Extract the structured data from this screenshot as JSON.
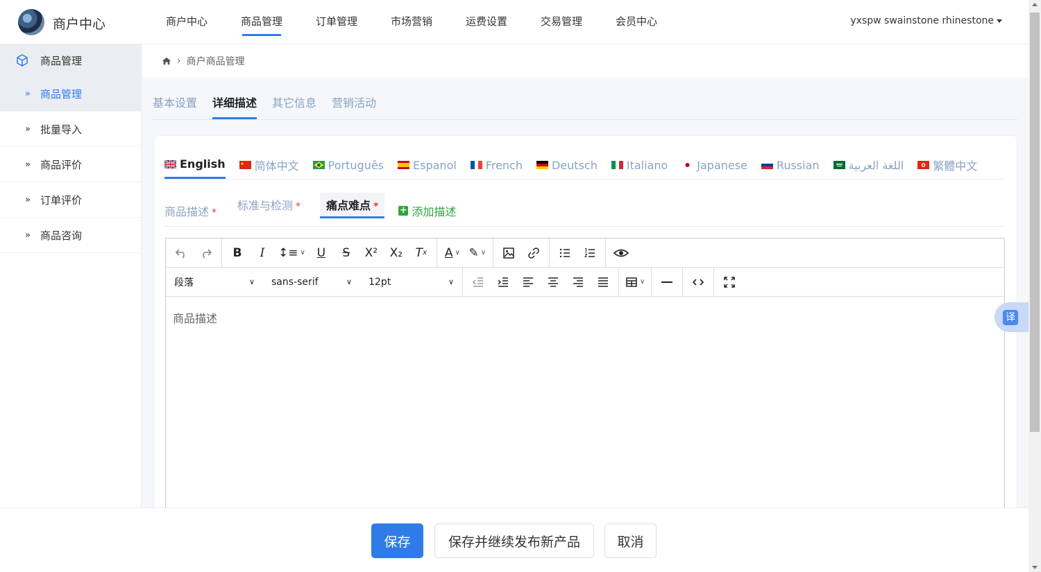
{
  "header": {
    "brand": "商户中心",
    "nav": [
      "商户中心",
      "商品管理",
      "订单管理",
      "市场营销",
      "运费设置",
      "交易管理",
      "会员中心"
    ],
    "active_nav": "商品管理",
    "user": "yxspw swainstone rhinestone"
  },
  "sidebar": {
    "title": "商品管理",
    "items": [
      {
        "label": "商品管理",
        "active": true
      },
      {
        "label": "批量导入",
        "active": false
      },
      {
        "label": "商品评价",
        "active": false
      },
      {
        "label": "订单评价",
        "active": false
      },
      {
        "label": "商品咨询",
        "active": false
      }
    ],
    "chevron": "»"
  },
  "breadcrumb": {
    "home_icon": "home-icon",
    "separator": "›",
    "current": "商户商品管理"
  },
  "tabs": [
    {
      "label": "基本设置",
      "active": false
    },
    {
      "label": "详细描述",
      "active": true
    },
    {
      "label": "其它信息",
      "active": false
    },
    {
      "label": "营销活动",
      "active": false
    }
  ],
  "languages": [
    {
      "label": "English",
      "active": true,
      "flag": "uk"
    },
    {
      "label": "简体中文",
      "active": false,
      "flag": "cn"
    },
    {
      "label": "Português",
      "active": false,
      "flag": "br"
    },
    {
      "label": "Espanol",
      "active": false,
      "flag": "es"
    },
    {
      "label": "French",
      "active": false,
      "flag": "fr"
    },
    {
      "label": "Deutsch",
      "active": false,
      "flag": "de"
    },
    {
      "label": "Italiano",
      "active": false,
      "flag": "it"
    },
    {
      "label": "Japanese",
      "active": false,
      "flag": "jp"
    },
    {
      "label": "Russian",
      "active": false,
      "flag": "ru"
    },
    {
      "label": "اللغة العربية",
      "active": false,
      "flag": "sa"
    },
    {
      "label": "繁體中文",
      "active": false,
      "flag": "hk"
    }
  ],
  "subtabs": [
    {
      "label": "商品描述",
      "required_mark": "*",
      "active": false
    },
    {
      "label": "标准与检测",
      "required_mark": "*",
      "active": false
    },
    {
      "label": "痛点难点",
      "required_mark": "*",
      "active": true
    }
  ],
  "add_desc_label": "添加描述",
  "add_desc_plus": "+",
  "editor": {
    "block_format": "段落",
    "font_family": "sans-serif",
    "font_size": "12pt",
    "content": "商品描述"
  },
  "footer": {
    "save": "保存",
    "save_continue": "保存并继续发布新产品",
    "cancel": "取消"
  },
  "translate_badge": "译",
  "colors": {
    "accent": "#2f7ce8",
    "required": "#e03b3b",
    "add": "#2fa53c",
    "inactive_tab": "#8aa2c2"
  }
}
